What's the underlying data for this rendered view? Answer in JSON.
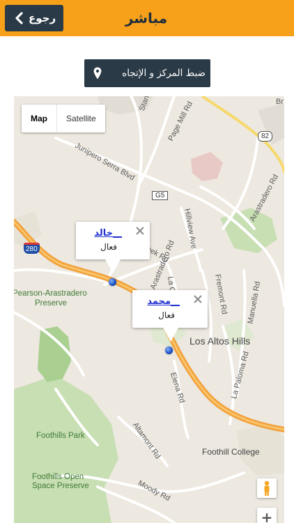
{
  "header": {
    "title": "مباشر",
    "back_label": "رجوع",
    "bg_color": "#f7a11a"
  },
  "toolbar": {
    "center_label": "ضبط المركز و الإتجاه",
    "center_icon": "map-pin-icon"
  },
  "map": {
    "map_type_options": [
      "Map",
      "Satellite"
    ],
    "selected_map_type": "Map",
    "labels": {
      "junipero": "Junipero Serra Blvd",
      "page_mill": "Page Mill Rd",
      "stanford": "Stan",
      "arastradero": "Arastradero Rd",
      "arastradero2": "Arastradero Rd",
      "hillview": "Hillview Ave",
      "creek": "Creek Rd",
      "la_cresta": "La C",
      "fremont": "Fremont Rd",
      "manuella": "Manuella Rd",
      "la_paloma": "La Paloma Rd",
      "elena": "Elena Rd",
      "altamont": "Altamont Rd",
      "moody": "Moody Rd",
      "pearson": "Pearson-Arastradero",
      "preserve": "Preserve",
      "los_altos_hills": "Los Altos Hills",
      "foothills_park": "Foothills Park",
      "foothills_open": "Foothills Open",
      "space_preserve": "Space Preserve",
      "foothill_college": "Foothill College",
      "shield_280": "280",
      "shield_82": "82",
      "shield_g5": "G5",
      "br": "Br"
    },
    "markers": [
      {
        "name": "خالد__",
        "status": "فعال"
      },
      {
        "name": "محمد__",
        "status": "فعال"
      }
    ],
    "zoom_in": "+"
  }
}
